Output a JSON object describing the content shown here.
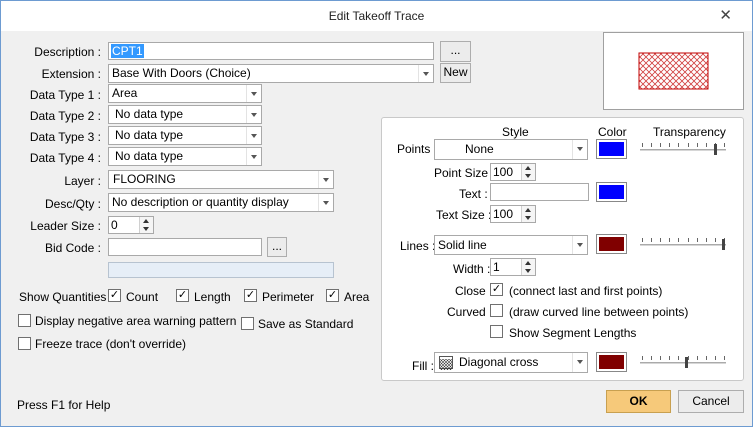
{
  "window": {
    "title": "Edit Takeoff Trace"
  },
  "left": {
    "description_label": "Description :",
    "description_value": "CPT1",
    "description_btn": "...",
    "extension_label": "Extension :",
    "extension_value": "Base With Doors (Choice)",
    "new_btn": "New",
    "dt1_label": "Data Type 1 :",
    "dt1_value": "Area",
    "dt2_label": "Data Type 2 :",
    "dt2_value": "No data type",
    "dt3_label": "Data Type 3 :",
    "dt3_value": "No data type",
    "dt4_label": "Data Type 4 :",
    "dt4_value": "No data type",
    "layer_label": "Layer :",
    "layer_value": "FLOORING",
    "descqty_label": "Desc/Qty :",
    "descqty_value": "No description or quantity display",
    "leader_label": "Leader Size :",
    "leader_value": "0",
    "bidcode_label": "Bid Code :",
    "bidcode_value": "",
    "bidcode_btn": "...",
    "showq_label": "Show Quantities :",
    "count_label": "Count",
    "length_label": "Length",
    "perimeter_label": "Perimeter",
    "area_label": "Area",
    "neg_label": "Display negative area warning pattern",
    "save_std_label": "Save as Standard",
    "freeze_label": "Freeze trace (don't override)",
    "help_text": "Press F1 for Help"
  },
  "style_panel": {
    "style_header": "Style",
    "color_header": "Color",
    "transparency_header": "Transparency",
    "points_label": "Points :",
    "points_value": "None",
    "point_size_label": "Point Size :",
    "point_size_value": "100",
    "text_label": "Text :",
    "text_value": "",
    "text_size_label": "Text Size :",
    "text_size_value": "100",
    "lines_label": "Lines :",
    "lines_value": "Solid line",
    "width_label": "Width :",
    "width_value": "1",
    "close_label": "Close :",
    "close_desc": "(connect last and first points)",
    "curved_label": "Curved :",
    "curved_desc": "(draw curved line between points)",
    "segment_label": "Show Segment Lengths",
    "fill_label": "Fill :",
    "fill_value": "Diagonal cross"
  },
  "colors": {
    "points_color": "#0000ff",
    "text_color": "#0000ff",
    "lines_color": "#800000",
    "fill_color": "#800000",
    "preview_hatch": "#d04040",
    "ok_bg": "#f6c97a"
  },
  "transparency": {
    "points": 0.9,
    "lines": 1.0,
    "fill": 0.55
  },
  "buttons": {
    "ok": "OK",
    "cancel": "Cancel"
  }
}
